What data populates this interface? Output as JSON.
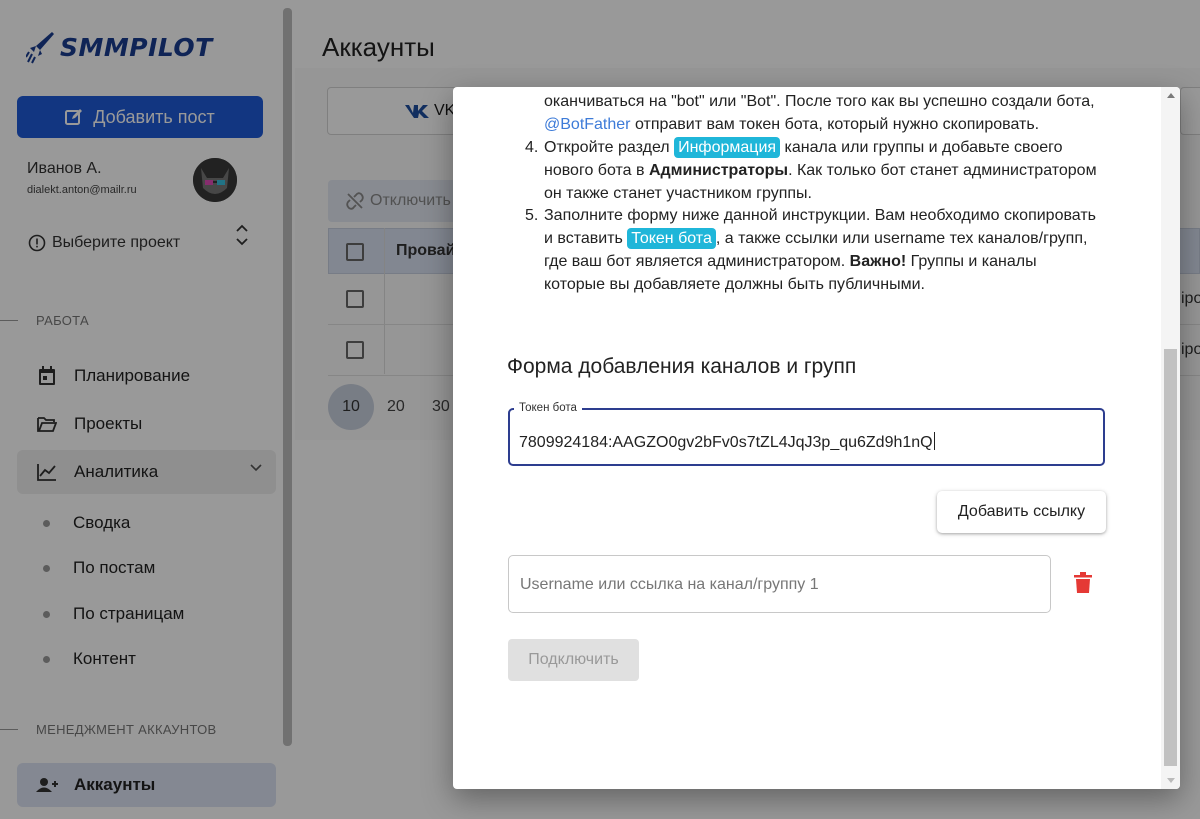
{
  "brand": {
    "name": "SMMPILOT",
    "primary_color": "#1e5bd8",
    "accent_color": "#1fb6d9"
  },
  "sidebar": {
    "add_post_label": "Добавить пост",
    "user": {
      "name": "Иванов А.",
      "email": "dialekt.anton@mailr.ru"
    },
    "project_select_label": "Выберите проект",
    "sections": {
      "work": "РАБОТА",
      "accounts_mgmt": "МЕНЕДЖМЕНТ АККАУНТОВ"
    },
    "items": {
      "planning": "Планирование",
      "projects": "Проекты",
      "analytics": "Аналитика",
      "accounts": "Аккаунты"
    },
    "analytics_sub": [
      "Сводка",
      "По постам",
      "По страницам",
      "Контент"
    ]
  },
  "main": {
    "title": "Аккаунты",
    "tab_vk": "VK",
    "disconnect_label": "Отключить",
    "table_header_provider": "Провай",
    "right_fragment": "іро",
    "pagination": [
      "10",
      "20",
      "30"
    ]
  },
  "dialog": {
    "instructions": {
      "l1_a": "оканчиваться на \"bot\" или \"Bot\". После того как вы успешно создали бота,",
      "l2_link": "@BotFather",
      "l2_b": " отправит вам токен бота, который нужно скопировать.",
      "n4": "4.",
      "l3_a": "Откройте раздел ",
      "l3_chip": "Информация",
      "l3_b": " канала или группы и добавьте своего",
      "l4_a": "нового бота в ",
      "l4_bold": "Администраторы",
      "l4_b": ". Как только бот станет администратором",
      "l5": "он также станет участником группы.",
      "n5": "5.",
      "l6": "Заполните форму ниже данной инструкции. Вам необходимо скопировать",
      "l7_a": "и вставить ",
      "l7_chip": "Токен бота",
      "l7_b": ", а также ссылки или username тех каналов/групп,",
      "l8_a": "где ваш бот является администратором. ",
      "l8_bold": "Важно!",
      "l8_b": " Группы и каналы",
      "l9": "которые вы добавляете должны быть публичными."
    },
    "form_title": "Форма добавления каналов и групп",
    "token_label": "Токен бота",
    "token_value": "7809924184:AAGZO0gv2bFv0s7tZL4JqJ3p_qu6Zd9h1nQ",
    "add_link_label": "Добавить ссылку",
    "link_placeholder": "Username или ссылка на канал/группу 1",
    "connect_label": "Подключить"
  }
}
